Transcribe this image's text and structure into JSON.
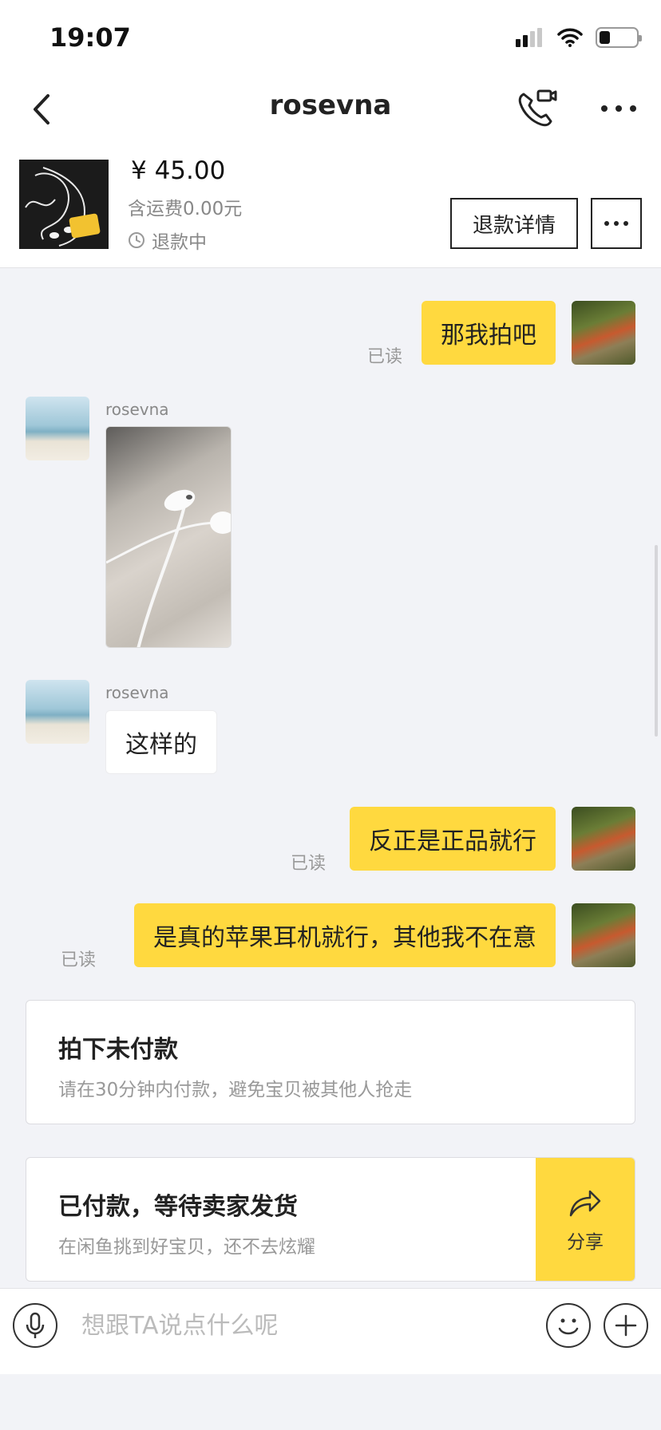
{
  "status_bar": {
    "time": "19:07",
    "battery_level": 0.3
  },
  "nav": {
    "title": "rosevna"
  },
  "product": {
    "price": "¥ 45.00",
    "shipping": "含运费0.00元",
    "status": "退款中",
    "refund_button": "退款详情"
  },
  "messages": {
    "m1": {
      "text": "那我拍吧",
      "read": "已读"
    },
    "m2": {
      "sender": "rosevna"
    },
    "m3": {
      "sender": "rosevna",
      "text": "这样的"
    },
    "m4": {
      "text": "反正是正品就行",
      "read": "已读"
    },
    "m5": {
      "text": "是真的苹果耳机就行，其他我不在意",
      "read": "已读"
    }
  },
  "cards": {
    "unpaid": {
      "title": "拍下未付款",
      "subtitle": "请在30分钟内付款，避免宝贝被其他人抢走"
    },
    "paid": {
      "title": "已付款，等待卖家发货",
      "subtitle": "在闲鱼挑到好宝贝，还不去炫耀",
      "share_label": "分享"
    }
  },
  "input": {
    "placeholder": "想跟TA说点什么呢"
  },
  "icons": [
    "signal-icon",
    "wifi-icon",
    "battery-icon",
    "back-icon",
    "phone-video-icon",
    "more-icon",
    "clock-icon",
    "share-icon",
    "mic-icon",
    "emoji-icon",
    "plus-icon"
  ],
  "colors": {
    "accent": "#ffd93f",
    "background": "#f2f3f7"
  }
}
